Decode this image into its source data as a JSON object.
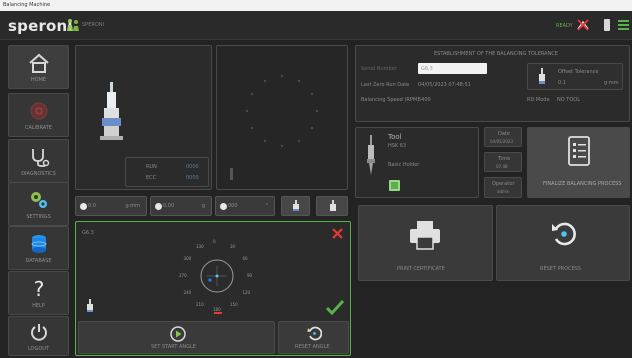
{
  "window_title": "Balancing Machine",
  "brand": {
    "logo": "speroni",
    "sub": "SPERONI"
  },
  "status": {
    "ready": "READY"
  },
  "sidebar": [
    {
      "label": "HOME"
    },
    {
      "label": "CALIBRATE"
    },
    {
      "label": "DIAGNOSTICS"
    },
    {
      "label": "SETTINGS"
    },
    {
      "label": "DATABASE"
    },
    {
      "label": "HELP"
    },
    {
      "label": "LOGOUT"
    }
  ],
  "left_panel": {
    "values": [
      {
        "k": "RUN",
        "v": "0000"
      },
      {
        "k": "ECC",
        "v": "0000"
      }
    ]
  },
  "params": [
    {
      "value": "0.0",
      "unit": "g·mm"
    },
    {
      "value": "0.00",
      "unit": "g"
    },
    {
      "value": "000",
      "unit": "°"
    }
  ],
  "polar": {
    "label": "G6.3",
    "ticks": [
      "0",
      "30",
      "60",
      "90",
      "120",
      "150",
      "180",
      "210",
      "240",
      "270",
      "300",
      "330"
    ]
  },
  "bottom_actions": {
    "start": "SET START ANGLE",
    "reset": "RESET ANGLE"
  },
  "tolerance": {
    "header": "ESTABLISHMENT OF THE BALANCING TOLERANCE",
    "input_placeholder": "Serial Number",
    "input_value": "G6.3",
    "rows": [
      {
        "k": "Last Zero Run Date",
        "v": "04/05/2023 07:48:51"
      },
      {
        "k": "Balancing Speed (RPM)",
        "v": "5400"
      }
    ],
    "offset": {
      "title": "Offset Tolerance",
      "v1": "0.1",
      "v2": "g·mm"
    },
    "rd_mode": {
      "k": "RD Mode",
      "v": "NO TOOL"
    }
  },
  "tool": {
    "title": "Tool",
    "code": "HSK 63",
    "holder": "Basic Holder"
  },
  "side_info": [
    {
      "k": "Date",
      "v": "04/05/2023"
    },
    {
      "k": "Time",
      "v": "07:48"
    },
    {
      "k": "Operator",
      "v": "admin"
    }
  ],
  "finalize": {
    "label": "FINALIZE BALANCING PROCESS"
  },
  "actions": {
    "print": "PRINT CERTIFICATE",
    "reset_process": "RESET PROCESS"
  },
  "colors": {
    "accent_green": "#58b24a",
    "error_red": "#e53935",
    "brand_green": "#6aa84f"
  }
}
